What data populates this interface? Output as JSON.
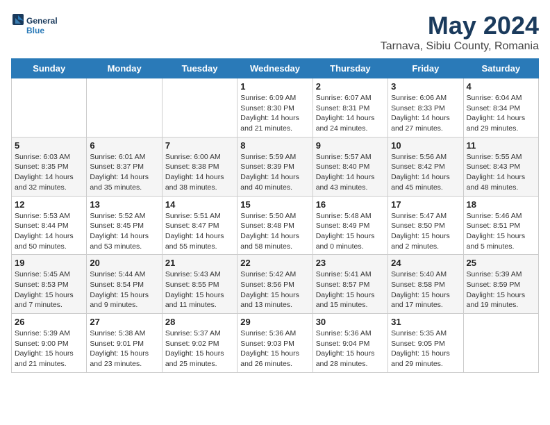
{
  "header": {
    "logo_line1": "General",
    "logo_line2": "Blue",
    "month": "May 2024",
    "location": "Tarnava, Sibiu County, Romania"
  },
  "days_of_week": [
    "Sunday",
    "Monday",
    "Tuesday",
    "Wednesday",
    "Thursday",
    "Friday",
    "Saturday"
  ],
  "weeks": [
    [
      {
        "num": "",
        "info": ""
      },
      {
        "num": "",
        "info": ""
      },
      {
        "num": "",
        "info": ""
      },
      {
        "num": "1",
        "info": "Sunrise: 6:09 AM\nSunset: 8:30 PM\nDaylight: 14 hours\nand 21 minutes."
      },
      {
        "num": "2",
        "info": "Sunrise: 6:07 AM\nSunset: 8:31 PM\nDaylight: 14 hours\nand 24 minutes."
      },
      {
        "num": "3",
        "info": "Sunrise: 6:06 AM\nSunset: 8:33 PM\nDaylight: 14 hours\nand 27 minutes."
      },
      {
        "num": "4",
        "info": "Sunrise: 6:04 AM\nSunset: 8:34 PM\nDaylight: 14 hours\nand 29 minutes."
      }
    ],
    [
      {
        "num": "5",
        "info": "Sunrise: 6:03 AM\nSunset: 8:35 PM\nDaylight: 14 hours\nand 32 minutes."
      },
      {
        "num": "6",
        "info": "Sunrise: 6:01 AM\nSunset: 8:37 PM\nDaylight: 14 hours\nand 35 minutes."
      },
      {
        "num": "7",
        "info": "Sunrise: 6:00 AM\nSunset: 8:38 PM\nDaylight: 14 hours\nand 38 minutes."
      },
      {
        "num": "8",
        "info": "Sunrise: 5:59 AM\nSunset: 8:39 PM\nDaylight: 14 hours\nand 40 minutes."
      },
      {
        "num": "9",
        "info": "Sunrise: 5:57 AM\nSunset: 8:40 PM\nDaylight: 14 hours\nand 43 minutes."
      },
      {
        "num": "10",
        "info": "Sunrise: 5:56 AM\nSunset: 8:42 PM\nDaylight: 14 hours\nand 45 minutes."
      },
      {
        "num": "11",
        "info": "Sunrise: 5:55 AM\nSunset: 8:43 PM\nDaylight: 14 hours\nand 48 minutes."
      }
    ],
    [
      {
        "num": "12",
        "info": "Sunrise: 5:53 AM\nSunset: 8:44 PM\nDaylight: 14 hours\nand 50 minutes."
      },
      {
        "num": "13",
        "info": "Sunrise: 5:52 AM\nSunset: 8:45 PM\nDaylight: 14 hours\nand 53 minutes."
      },
      {
        "num": "14",
        "info": "Sunrise: 5:51 AM\nSunset: 8:47 PM\nDaylight: 14 hours\nand 55 minutes."
      },
      {
        "num": "15",
        "info": "Sunrise: 5:50 AM\nSunset: 8:48 PM\nDaylight: 14 hours\nand 58 minutes."
      },
      {
        "num": "16",
        "info": "Sunrise: 5:48 AM\nSunset: 8:49 PM\nDaylight: 15 hours\nand 0 minutes."
      },
      {
        "num": "17",
        "info": "Sunrise: 5:47 AM\nSunset: 8:50 PM\nDaylight: 15 hours\nand 2 minutes."
      },
      {
        "num": "18",
        "info": "Sunrise: 5:46 AM\nSunset: 8:51 PM\nDaylight: 15 hours\nand 5 minutes."
      }
    ],
    [
      {
        "num": "19",
        "info": "Sunrise: 5:45 AM\nSunset: 8:53 PM\nDaylight: 15 hours\nand 7 minutes."
      },
      {
        "num": "20",
        "info": "Sunrise: 5:44 AM\nSunset: 8:54 PM\nDaylight: 15 hours\nand 9 minutes."
      },
      {
        "num": "21",
        "info": "Sunrise: 5:43 AM\nSunset: 8:55 PM\nDaylight: 15 hours\nand 11 minutes."
      },
      {
        "num": "22",
        "info": "Sunrise: 5:42 AM\nSunset: 8:56 PM\nDaylight: 15 hours\nand 13 minutes."
      },
      {
        "num": "23",
        "info": "Sunrise: 5:41 AM\nSunset: 8:57 PM\nDaylight: 15 hours\nand 15 minutes."
      },
      {
        "num": "24",
        "info": "Sunrise: 5:40 AM\nSunset: 8:58 PM\nDaylight: 15 hours\nand 17 minutes."
      },
      {
        "num": "25",
        "info": "Sunrise: 5:39 AM\nSunset: 8:59 PM\nDaylight: 15 hours\nand 19 minutes."
      }
    ],
    [
      {
        "num": "26",
        "info": "Sunrise: 5:39 AM\nSunset: 9:00 PM\nDaylight: 15 hours\nand 21 minutes."
      },
      {
        "num": "27",
        "info": "Sunrise: 5:38 AM\nSunset: 9:01 PM\nDaylight: 15 hours\nand 23 minutes."
      },
      {
        "num": "28",
        "info": "Sunrise: 5:37 AM\nSunset: 9:02 PM\nDaylight: 15 hours\nand 25 minutes."
      },
      {
        "num": "29",
        "info": "Sunrise: 5:36 AM\nSunset: 9:03 PM\nDaylight: 15 hours\nand 26 minutes."
      },
      {
        "num": "30",
        "info": "Sunrise: 5:36 AM\nSunset: 9:04 PM\nDaylight: 15 hours\nand 28 minutes."
      },
      {
        "num": "31",
        "info": "Sunrise: 5:35 AM\nSunset: 9:05 PM\nDaylight: 15 hours\nand 29 minutes."
      },
      {
        "num": "",
        "info": ""
      }
    ]
  ]
}
